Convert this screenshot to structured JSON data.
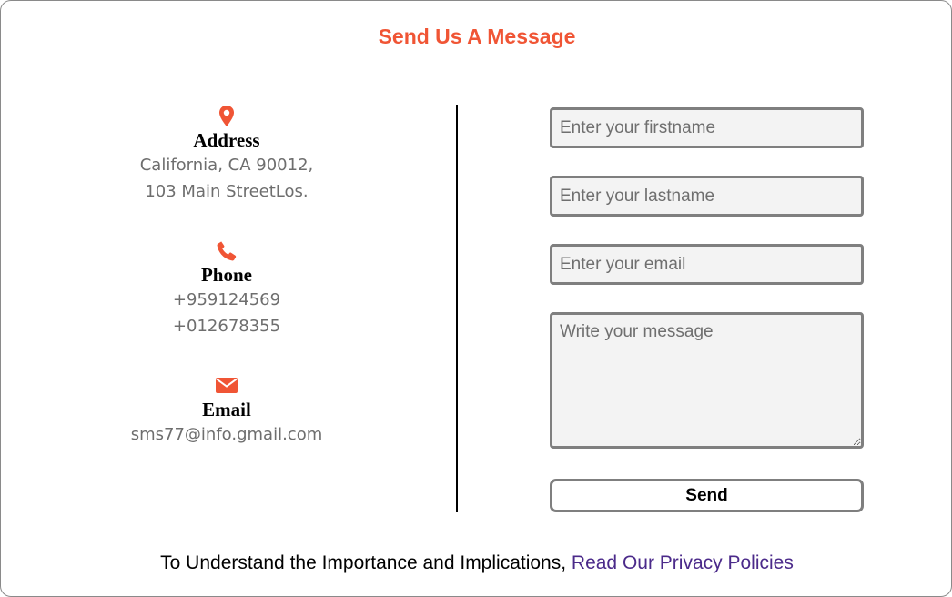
{
  "header": {
    "title": "Send Us A Message"
  },
  "contact": {
    "address": {
      "icon": "location-pin-icon",
      "label": "Address",
      "lines": [
        "California, CA 90012,",
        "103 Main StreetLos."
      ]
    },
    "phone": {
      "icon": "phone-icon",
      "label": "Phone",
      "lines": [
        "+959124569",
        "+012678355"
      ]
    },
    "email": {
      "icon": "envelope-icon",
      "label": "Email",
      "lines": [
        "sms77@info.gmail.com"
      ]
    }
  },
  "form": {
    "firstname_placeholder": "Enter your firstname",
    "lastname_placeholder": "Enter your lastname",
    "email_placeholder": "Enter your email",
    "message_placeholder": "Write your message",
    "send_label": "Send"
  },
  "footer": {
    "text": "To Understand the Importance and Implications, ",
    "link": "Read Our Privacy Policies"
  },
  "colors": {
    "accent": "#f05535",
    "link": "#4b2a8a",
    "field_bg": "#f3f3f3",
    "border": "#7f7f7f"
  }
}
